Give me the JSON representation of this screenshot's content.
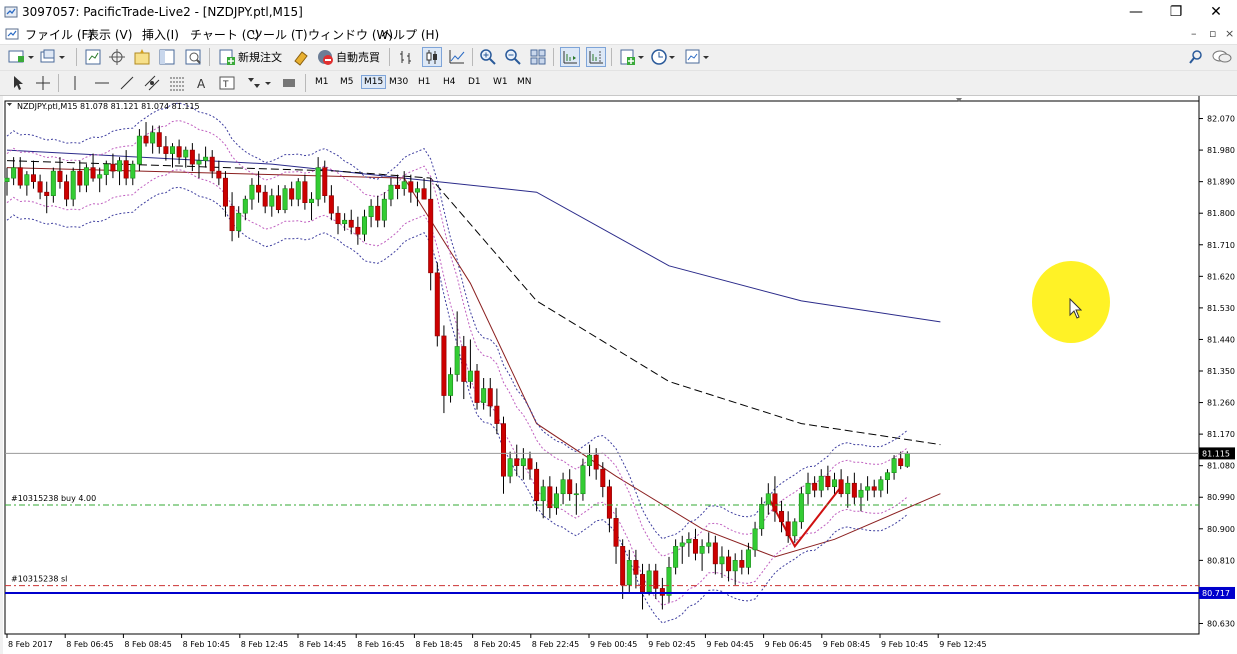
{
  "window": {
    "title": "3097057: PacificTrade-Live2 - [NZDJPY.ptl,M15]",
    "controls": {
      "minimize": "—",
      "restore": "❐",
      "close": "✕"
    }
  },
  "menu": {
    "items": [
      "ファイル (F)",
      "表示 (V)",
      "挿入(I)",
      "チャート (C)",
      "ツール (T)",
      "ウィンドウ (W)",
      "ヘルプ (H)"
    ],
    "mdi_controls": {
      "minimize": "–",
      "restore": "▫",
      "close": "×"
    }
  },
  "toolbar": {
    "new_order": "新規注文",
    "auto_trade": "自動売買"
  },
  "timeframes": {
    "items": [
      "M1",
      "M5",
      "M15",
      "M30",
      "H1",
      "H4",
      "D1",
      "W1",
      "MN"
    ],
    "active": "M15"
  },
  "chart_data": {
    "type": "candlestick",
    "symbol_header": "NZDJPY.ptl,M15  81.078 81.121 81.074 81.115",
    "ylim": [
      80.6,
      82.12
    ],
    "y_ticks": [
      "82.070",
      "81.980",
      "81.890",
      "81.800",
      "81.710",
      "81.620",
      "81.530",
      "81.440",
      "81.350",
      "81.260",
      "81.170",
      "81.080",
      "80.990",
      "80.900",
      "80.810",
      "80.630"
    ],
    "x_ticks": [
      "8 Feb 2017",
      "8 Feb 06:45",
      "8 Feb 08:45",
      "8 Feb 10:45",
      "8 Feb 12:45",
      "8 Feb 14:45",
      "8 Feb 16:45",
      "8 Feb 18:45",
      "8 Feb 20:45",
      "8 Feb 22:45",
      "9 Feb 00:45",
      "9 Feb 02:45",
      "9 Feb 04:45",
      "9 Feb 06:45",
      "9 Feb 08:45",
      "9 Feb 10:45",
      "9 Feb 12:45"
    ],
    "current_price": {
      "label": "81.115",
      "value": 81.115
    },
    "orders": [
      {
        "label": "#10315238 buy 4.00",
        "value": 80.968
      },
      {
        "label": "#10315238 sl",
        "value": 80.738
      }
    ],
    "sl_tag": {
      "label": "80.717",
      "value": 80.717
    },
    "candles": [
      [
        81.89,
        81.93,
        81.85,
        81.9
      ],
      [
        81.9,
        81.96,
        81.88,
        81.93
      ],
      [
        81.93,
        81.96,
        81.87,
        81.88
      ],
      [
        81.88,
        81.92,
        81.85,
        81.91
      ],
      [
        81.91,
        81.95,
        81.87,
        81.89
      ],
      [
        81.89,
        81.91,
        81.84,
        81.86
      ],
      [
        81.86,
        81.89,
        81.8,
        81.85
      ],
      [
        81.85,
        81.93,
        81.83,
        81.92
      ],
      [
        81.92,
        81.96,
        81.87,
        81.89
      ],
      [
        81.89,
        81.91,
        81.82,
        81.84
      ],
      [
        81.84,
        81.93,
        81.82,
        81.92
      ],
      [
        81.92,
        81.95,
        81.86,
        81.88
      ],
      [
        81.88,
        81.94,
        81.86,
        81.93
      ],
      [
        81.93,
        81.97,
        81.89,
        81.9
      ],
      [
        81.9,
        81.93,
        81.86,
        81.91
      ],
      [
        81.91,
        81.95,
        81.88,
        81.94
      ],
      [
        81.94,
        81.97,
        81.9,
        81.92
      ],
      [
        81.92,
        81.96,
        81.88,
        81.95
      ],
      [
        81.95,
        81.98,
        81.88,
        81.9
      ],
      [
        81.9,
        81.95,
        81.88,
        81.94
      ],
      [
        81.94,
        82.04,
        81.92,
        82.02
      ],
      [
        82.02,
        82.06,
        81.99,
        82.0
      ],
      [
        82.0,
        82.05,
        81.97,
        82.03
      ],
      [
        82.03,
        82.05,
        81.97,
        81.99
      ],
      [
        81.99,
        82.02,
        81.95,
        81.97
      ],
      [
        81.97,
        82.0,
        81.93,
        81.99
      ],
      [
        81.99,
        82.01,
        81.94,
        81.96
      ],
      [
        81.96,
        81.99,
        81.93,
        81.98
      ],
      [
        81.98,
        82.0,
        81.92,
        81.94
      ],
      [
        81.94,
        81.97,
        81.9,
        81.95
      ],
      [
        81.95,
        81.99,
        81.93,
        81.96
      ],
      [
        81.96,
        81.98,
        81.9,
        81.92
      ],
      [
        81.92,
        81.95,
        81.88,
        81.9
      ],
      [
        81.9,
        81.92,
        81.79,
        81.82
      ],
      [
        81.82,
        81.86,
        81.72,
        81.75
      ],
      [
        81.75,
        81.82,
        81.73,
        81.8
      ],
      [
        81.8,
        81.85,
        81.78,
        81.84
      ],
      [
        81.84,
        81.9,
        81.81,
        81.88
      ],
      [
        81.88,
        81.92,
        81.83,
        81.86
      ],
      [
        81.86,
        81.88,
        81.8,
        81.82
      ],
      [
        81.82,
        81.87,
        81.79,
        81.85
      ],
      [
        81.85,
        81.88,
        81.8,
        81.81
      ],
      [
        81.81,
        81.88,
        81.8,
        81.87
      ],
      [
        81.87,
        81.89,
        81.82,
        81.84
      ],
      [
        81.84,
        81.9,
        81.82,
        81.89
      ],
      [
        81.89,
        81.91,
        81.81,
        81.83
      ],
      [
        81.83,
        81.86,
        81.78,
        81.84
      ],
      [
        81.84,
        81.96,
        81.82,
        81.93
      ],
      [
        81.93,
        81.95,
        81.83,
        81.85
      ],
      [
        81.85,
        81.88,
        81.78,
        81.8
      ],
      [
        81.8,
        81.82,
        81.74,
        81.77
      ],
      [
        81.77,
        81.8,
        81.75,
        81.78
      ],
      [
        81.78,
        81.81,
        81.74,
        81.76
      ],
      [
        81.76,
        81.79,
        81.71,
        81.74
      ],
      [
        81.74,
        81.81,
        81.72,
        81.79
      ],
      [
        81.79,
        81.84,
        81.76,
        81.82
      ],
      [
        81.82,
        81.85,
        81.76,
        81.78
      ],
      [
        81.78,
        81.86,
        81.76,
        81.84
      ],
      [
        81.84,
        81.9,
        81.82,
        81.88
      ],
      [
        81.88,
        81.91,
        81.84,
        81.87
      ],
      [
        81.87,
        81.92,
        81.85,
        81.89
      ],
      [
        81.89,
        81.91,
        81.83,
        81.86
      ],
      [
        81.86,
        81.89,
        81.82,
        81.87
      ],
      [
        81.87,
        81.9,
        81.84,
        81.84
      ],
      [
        81.84,
        81.9,
        81.58,
        81.63
      ],
      [
        81.63,
        81.66,
        81.42,
        81.45
      ],
      [
        81.45,
        81.48,
        81.23,
        81.28
      ],
      [
        81.28,
        81.36,
        81.26,
        81.34
      ],
      [
        81.34,
        81.52,
        81.32,
        81.42
      ],
      [
        81.42,
        81.45,
        81.27,
        81.32
      ],
      [
        81.32,
        81.44,
        81.3,
        81.35
      ],
      [
        81.35,
        81.37,
        81.24,
        81.26
      ],
      [
        81.26,
        81.33,
        81.24,
        81.3
      ],
      [
        81.3,
        81.33,
        81.22,
        81.25
      ],
      [
        81.25,
        81.3,
        81.17,
        81.2
      ],
      [
        81.2,
        81.22,
        81.0,
        81.05
      ],
      [
        81.05,
        81.12,
        81.03,
        81.1
      ],
      [
        81.1,
        81.14,
        81.05,
        81.08
      ],
      [
        81.08,
        81.13,
        81.04,
        81.1
      ],
      [
        81.1,
        81.12,
        81.04,
        81.07
      ],
      [
        81.07,
        81.09,
        80.95,
        80.98
      ],
      [
        80.98,
        81.04,
        80.93,
        81.02
      ],
      [
        81.02,
        81.05,
        80.93,
        80.96
      ],
      [
        80.96,
        81.02,
        80.94,
        81.0
      ],
      [
        81.0,
        81.06,
        80.97,
        81.04
      ],
      [
        81.04,
        81.07,
        80.98,
        81.0
      ],
      [
        81.0,
        81.03,
        80.94,
        81.0
      ],
      [
        81.0,
        81.1,
        80.98,
        81.08
      ],
      [
        81.08,
        81.14,
        81.05,
        81.11
      ],
      [
        81.11,
        81.13,
        81.04,
        81.07
      ],
      [
        81.07,
        81.09,
        80.99,
        81.02
      ],
      [
        81.02,
        81.04,
        80.89,
        80.93
      ],
      [
        80.93,
        80.96,
        80.8,
        80.85
      ],
      [
        80.85,
        80.87,
        80.7,
        80.74
      ],
      [
        80.74,
        80.84,
        80.72,
        80.81
      ],
      [
        80.81,
        80.84,
        80.73,
        80.77
      ],
      [
        80.77,
        80.8,
        80.67,
        80.72
      ],
      [
        80.72,
        80.8,
        80.71,
        80.78
      ],
      [
        80.78,
        80.8,
        80.7,
        80.73
      ],
      [
        80.73,
        80.76,
        80.67,
        80.71
      ],
      [
        80.71,
        80.82,
        80.69,
        80.79
      ],
      [
        80.79,
        80.87,
        80.77,
        80.85
      ],
      [
        80.85,
        80.88,
        80.8,
        80.86
      ],
      [
        80.86,
        80.89,
        80.82,
        80.87
      ],
      [
        80.87,
        80.9,
        80.81,
        80.83
      ],
      [
        80.83,
        80.87,
        80.78,
        80.85
      ],
      [
        80.85,
        80.89,
        80.83,
        80.86
      ],
      [
        80.86,
        80.88,
        80.77,
        80.8
      ],
      [
        80.8,
        80.85,
        80.76,
        80.82
      ],
      [
        80.82,
        80.84,
        80.75,
        80.78
      ],
      [
        80.78,
        80.83,
        80.74,
        80.81
      ],
      [
        80.81,
        80.84,
        80.77,
        80.79
      ],
      [
        80.79,
        80.86,
        80.77,
        80.84
      ],
      [
        80.84,
        80.92,
        80.82,
        80.9
      ],
      [
        80.9,
        80.99,
        80.88,
        80.97
      ],
      [
        80.97,
        81.03,
        80.94,
        81.0
      ],
      [
        81.0,
        81.05,
        80.92,
        80.95
      ],
      [
        80.95,
        80.98,
        80.89,
        80.92
      ],
      [
        80.92,
        80.95,
        80.86,
        80.88
      ],
      [
        80.88,
        80.93,
        80.86,
        80.92
      ],
      [
        80.92,
        81.02,
        80.9,
        81.0
      ],
      [
        81.0,
        81.06,
        80.97,
        81.03
      ],
      [
        81.03,
        81.05,
        80.99,
        81.01
      ],
      [
        81.01,
        81.07,
        80.99,
        81.05
      ],
      [
        81.05,
        81.08,
        81.01,
        81.02
      ],
      [
        81.02,
        81.06,
        81.0,
        81.04
      ],
      [
        81.04,
        81.07,
        80.99,
        81.0
      ],
      [
        81.0,
        81.05,
        80.96,
        81.03
      ],
      [
        81.03,
        81.06,
        80.97,
        80.99
      ],
      [
        80.99,
        81.03,
        80.95,
        81.01
      ],
      [
        81.01,
        81.05,
        80.98,
        81.02
      ],
      [
        81.02,
        81.04,
        80.99,
        81.01
      ],
      [
        81.01,
        81.05,
        80.99,
        81.04
      ],
      [
        81.04,
        81.07,
        81.0,
        81.06
      ],
      [
        81.06,
        81.11,
        81.04,
        81.1
      ],
      [
        81.1,
        81.12,
        81.07,
        81.08
      ],
      [
        81.078,
        81.121,
        81.074,
        81.115
      ]
    ],
    "series": [
      {
        "color": "#2b2b8a",
        "values": [
          [
            81.98,
            0
          ],
          [
            81.96,
            20
          ],
          [
            81.94,
            40
          ],
          [
            81.9,
            60
          ],
          [
            81.86,
            80
          ],
          [
            81.65,
            100
          ],
          [
            81.55,
            120
          ],
          [
            81.49,
            141
          ]
        ]
      },
      {
        "color": "#000000",
        "values": [
          [
            81.95,
            0
          ],
          [
            81.92,
            50
          ],
          [
            81.9,
            64
          ],
          [
            81.55,
            80
          ],
          [
            81.32,
            100
          ],
          [
            81.2,
            120
          ],
          [
            81.14,
            141
          ]
        ]
      },
      {
        "color": "#8b2020",
        "values": [
          [
            81.93,
            0
          ],
          [
            81.9,
            60
          ],
          [
            81.6,
            70
          ],
          [
            81.2,
            80
          ],
          [
            81.05,
            92
          ],
          [
            80.9,
            105
          ],
          [
            80.82,
            116
          ],
          [
            80.87,
            125
          ],
          [
            81.0,
            141
          ]
        ]
      }
    ],
    "zigzag": {
      "color": "#d01010",
      "values": [
        [
          80.99,
          115
        ],
        [
          80.85,
          119
        ],
        [
          81.02,
          126
        ]
      ]
    }
  }
}
